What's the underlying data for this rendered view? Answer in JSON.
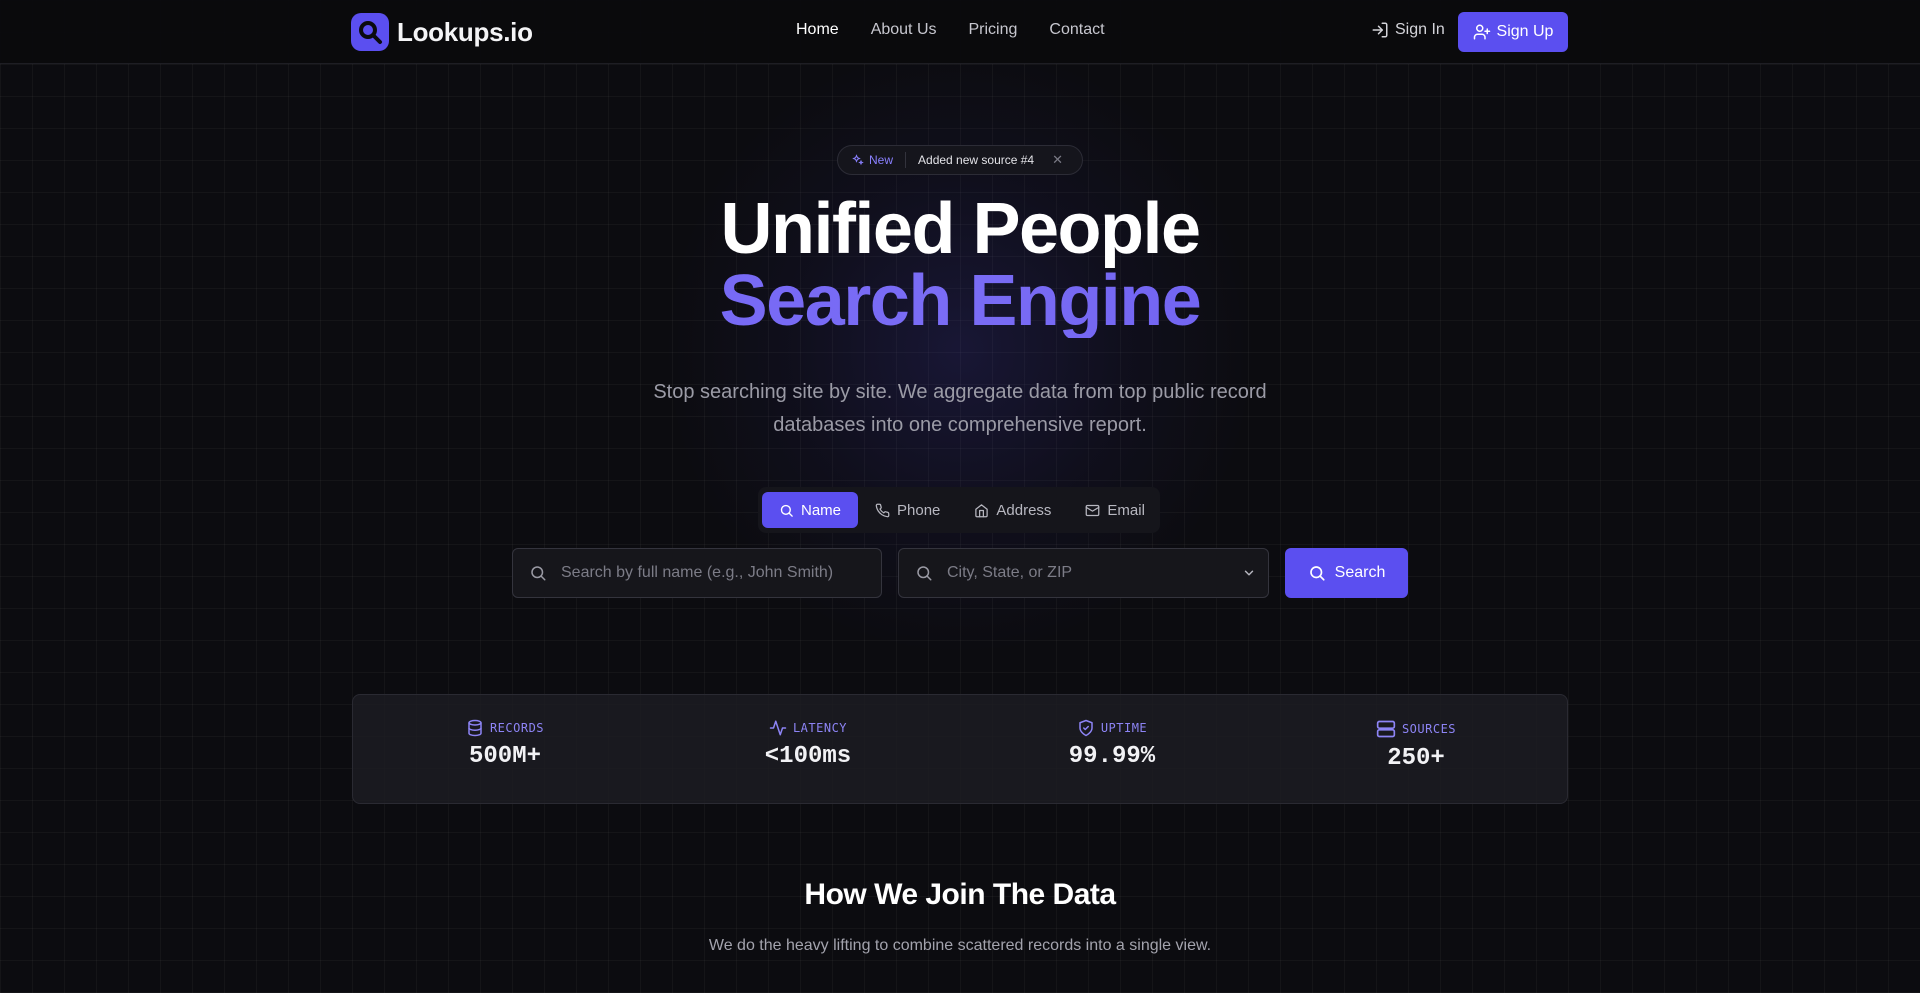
{
  "brand": {
    "name": "Lookups.io",
    "accent": "#5b4ff0"
  },
  "nav": {
    "links": [
      {
        "label": "Home",
        "active": true
      },
      {
        "label": "About Us",
        "active": false
      },
      {
        "label": "Pricing",
        "active": false
      },
      {
        "label": "Contact",
        "active": false
      }
    ],
    "sign_in": "Sign In",
    "sign_up": "Sign Up"
  },
  "announcement": {
    "badge": "New",
    "message": "Added new source #4",
    "close_icon": "close-icon"
  },
  "hero": {
    "title_line1": "Unified People",
    "title_line2": "Search Engine",
    "subtitle": "Stop searching site by site. We aggregate data from top public record databases into one comprehensive report."
  },
  "search": {
    "tabs": [
      {
        "label": "Name",
        "icon": "search-icon",
        "active": true
      },
      {
        "label": "Phone",
        "icon": "phone-icon",
        "active": false
      },
      {
        "label": "Address",
        "icon": "home-icon",
        "active": false
      },
      {
        "label": "Email",
        "icon": "mail-icon",
        "active": false
      }
    ],
    "name_placeholder": "Search by full name (e.g., John Smith)",
    "location_placeholder": "City, State, or ZIP",
    "button": "Search"
  },
  "stats": [
    {
      "label": "RECORDS",
      "value": "500M+",
      "icon": "database-icon"
    },
    {
      "label": "LATENCY",
      "value": "<100ms",
      "icon": "activity-icon"
    },
    {
      "label": "UPTIME",
      "value": "99.99%",
      "icon": "shield-check-icon"
    },
    {
      "label": "SOURCES",
      "value": "250+",
      "icon": "server-icon"
    }
  ],
  "section": {
    "title": "How We Join The Data",
    "subtitle": "We do the heavy lifting to combine scattered records into a single view."
  }
}
